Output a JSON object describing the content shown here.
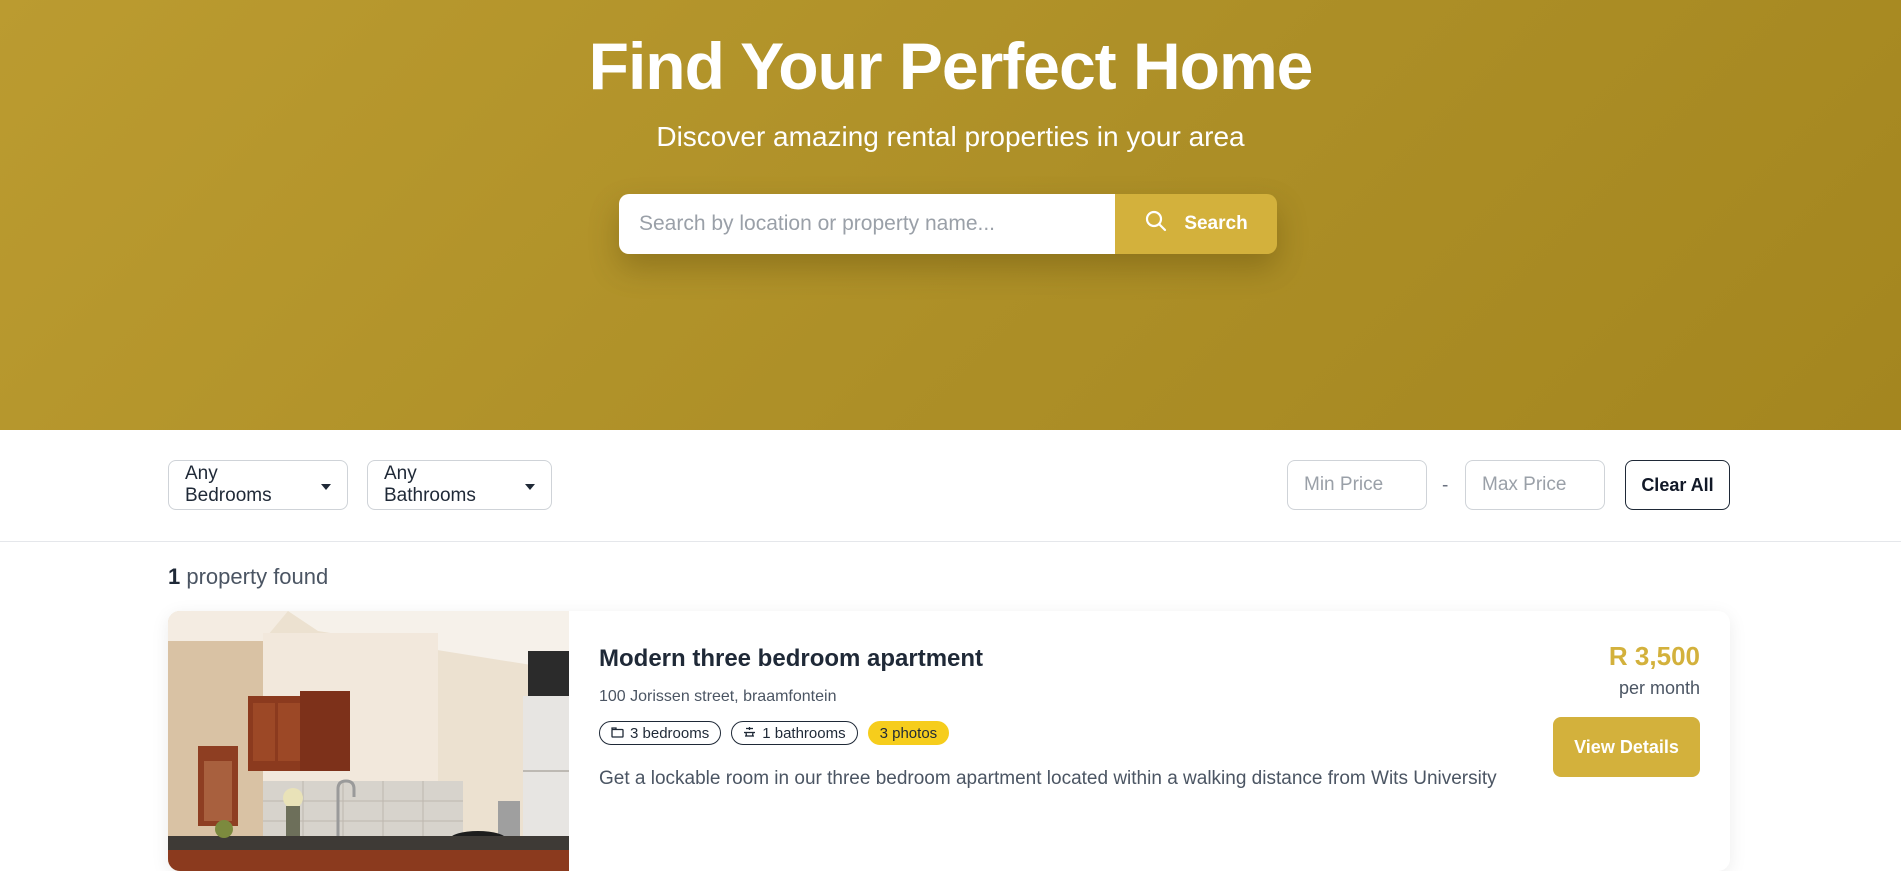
{
  "hero": {
    "title": "Find Your Perfect Home",
    "subtitle": "Discover amazing rental properties in your area",
    "search_placeholder": "Search by location or property name...",
    "search_button": "Search",
    "search_icon": "search-icon"
  },
  "filters": {
    "bedrooms": "Any Bedrooms",
    "bathrooms": "Any Bathrooms",
    "min_price_placeholder": "Min Price",
    "separator": "-",
    "max_price_placeholder": "Max Price",
    "clear_button": "Clear All"
  },
  "results": {
    "count": "1",
    "count_label": "property found"
  },
  "listings": [
    {
      "title": "Modern three bedroom apartment",
      "address": "100 Jorissen street, braamfontein",
      "tags": {
        "bedrooms": "3 bedrooms",
        "bathrooms": "1 bathrooms",
        "photos": "3 photos"
      },
      "description": "Get a lockable room in our three bedroom apartment located within a walking distance from Wits University",
      "price": "R 3,500",
      "price_period": "per month",
      "button": "View Details"
    }
  ],
  "colors": {
    "hero_background": "#b3952b",
    "accent": "#d3b13c",
    "photos_badge": "#f6cd1c",
    "text_dark": "#1f2937",
    "text_muted": "#4b5563"
  }
}
